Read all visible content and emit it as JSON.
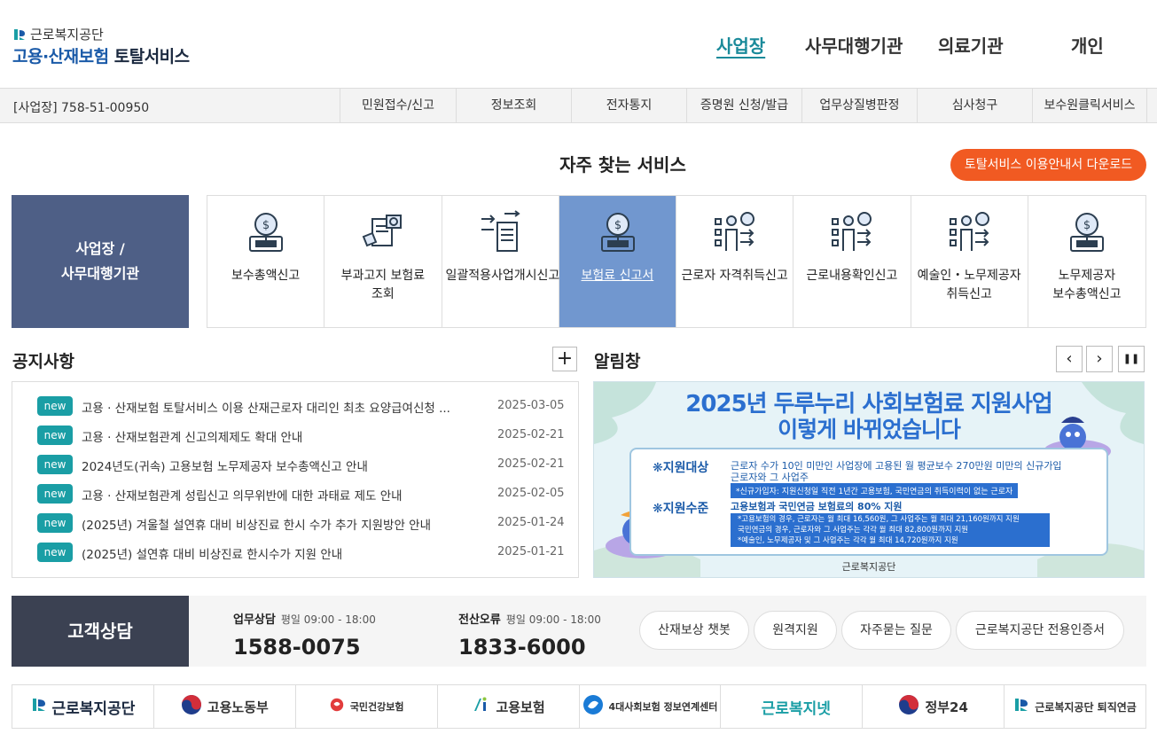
{
  "header": {
    "org_name": "근로복지공단",
    "title_part1": "고용·산재보험",
    "title_part2": "토탈서비스",
    "nav": [
      "사업장",
      "사무대행기관",
      "의료기관",
      "개인"
    ]
  },
  "subnav": {
    "biz_no": "[사업장] 758-51-00950",
    "items": [
      "민원접수/신고",
      "정보조회",
      "전자통지",
      "증명원 신청/발급",
      "업무상질병판정",
      "심사청구",
      "보수원클릭서비스"
    ]
  },
  "services": {
    "title": "자주 찾는 서비스",
    "guide_button": "토탈서비스 이용안내서 다운로드",
    "left_line1": "사업장 /",
    "left_line2": "사무대행기관",
    "items": [
      {
        "label": "보수총액신고",
        "icon": "money-bag-icon"
      },
      {
        "label": "부과고지 보험료 조회",
        "icon": "document-search-icon"
      },
      {
        "label": "일괄적용사업개시신고",
        "icon": "document-transfer-icon"
      },
      {
        "label": "보험료 신고서",
        "icon": "money-bag-icon"
      },
      {
        "label": "근로자 자격취득신고",
        "icon": "person-list-icon"
      },
      {
        "label": "근로내용확인신고",
        "icon": "person-list-icon"
      },
      {
        "label": "예술인・노무제공자 취득신고",
        "icon": "person-list-icon"
      },
      {
        "label": "노무제공자 보수총액신고",
        "icon": "money-bag-icon"
      }
    ],
    "active_index": 3
  },
  "notice": {
    "title": "공지사항",
    "more": "+",
    "badge": "new",
    "items": [
      {
        "text": "고용 · 산재보험 토탈서비스 이용 산재근로자 대리인 최초 요양급여신청 ...",
        "date": "2025-03-05"
      },
      {
        "text": "고용 · 산재보험관계 신고의제제도 확대 안내",
        "date": "2025-02-21"
      },
      {
        "text": "2024년도(귀속) 고용보험 노무제공자 보수총액신고 안내",
        "date": "2025-02-21"
      },
      {
        "text": "고용 · 산재보험관계 성립신고 의무위반에 대한 과태료 제도 안내",
        "date": "2025-02-05"
      },
      {
        "text": "(2025년) 겨울철 설연휴 대비 비상진료 한시 수가 추가 지원방안 안내",
        "date": "2025-01-24"
      },
      {
        "text": "(2025년) 설연휴 대비 비상진료 한시수가 지원 안내",
        "date": "2025-01-21"
      }
    ]
  },
  "alarm": {
    "title": "알림창",
    "prev": "‹",
    "next": "›",
    "pause": "❚❚",
    "banner": {
      "headline1": "2025년 두루누리 사회보험료 지원사업",
      "headline2": "이렇게 바뀌었습니다",
      "label1": "❋지원대상",
      "text1a": "근로자 수가 10인 미만인 사업장에 고용된 월 평균보수 270만원 미만의 신규가입",
      "text1b": "근로자와 그 사업주",
      "note1": "*신규가입자: 지원신청일 직전 1년간 고용보험, 국민연금의 취득이력이 없는 근로자",
      "label2": "❋지원수준",
      "text2": "고용보험과 국민연금 보험료의 80% 지원",
      "note2a": "*고용보험의 경우, 근로자는 월 최대 16,560원, 그 사업주는 월 최대 21,160원까지 지원",
      "note2b": "국민연금의 경우, 근로자와 그 사업주는 각각 월 최대 82,800원까지 지원",
      "note2c": "*예술인, 노무제공자 및 그 사업주는 각각 월 최대 14,720원까지 지원",
      "footer": "근로복지공단"
    }
  },
  "consult": {
    "title": "고객상담",
    "work_label": "업무상담",
    "work_hours": "평일 09:00 - 18:00",
    "work_phone": "1588-0075",
    "it_label": "전산오류",
    "it_hours": "평일 09:00 - 18:00",
    "it_phone": "1833-6000",
    "links": [
      "산재보상 챗봇",
      "원격지원",
      "자주묻는 질문",
      "근로복지공단 전용인증서"
    ]
  },
  "footer_logos": [
    {
      "name": "근로복지공단",
      "icon": "kcomwel-logo-icon"
    },
    {
      "name": "고용노동부",
      "icon": "taegeuk-icon"
    },
    {
      "name": "국민건강보험",
      "icon": "nhis-logo-icon"
    },
    {
      "name": "고용보험",
      "icon": "ei-logo-icon"
    },
    {
      "name": "4대사회보험 정보연계센터",
      "icon": "4insure-logo-icon"
    },
    {
      "name": "근로복지넷",
      "icon": "welfare-net-icon"
    },
    {
      "name": "정부24",
      "icon": "taegeuk-icon"
    },
    {
      "name": "근로복지공단 퇴직연금",
      "icon": "kcomwel-logo-icon"
    }
  ],
  "colors": {
    "accent": "#1a8a9a",
    "orange": "#f15a22",
    "navy": "#4e5f86",
    "active_cell": "#7197cf",
    "badge": "#1a9ea5",
    "consult_dark": "#3b4152"
  }
}
